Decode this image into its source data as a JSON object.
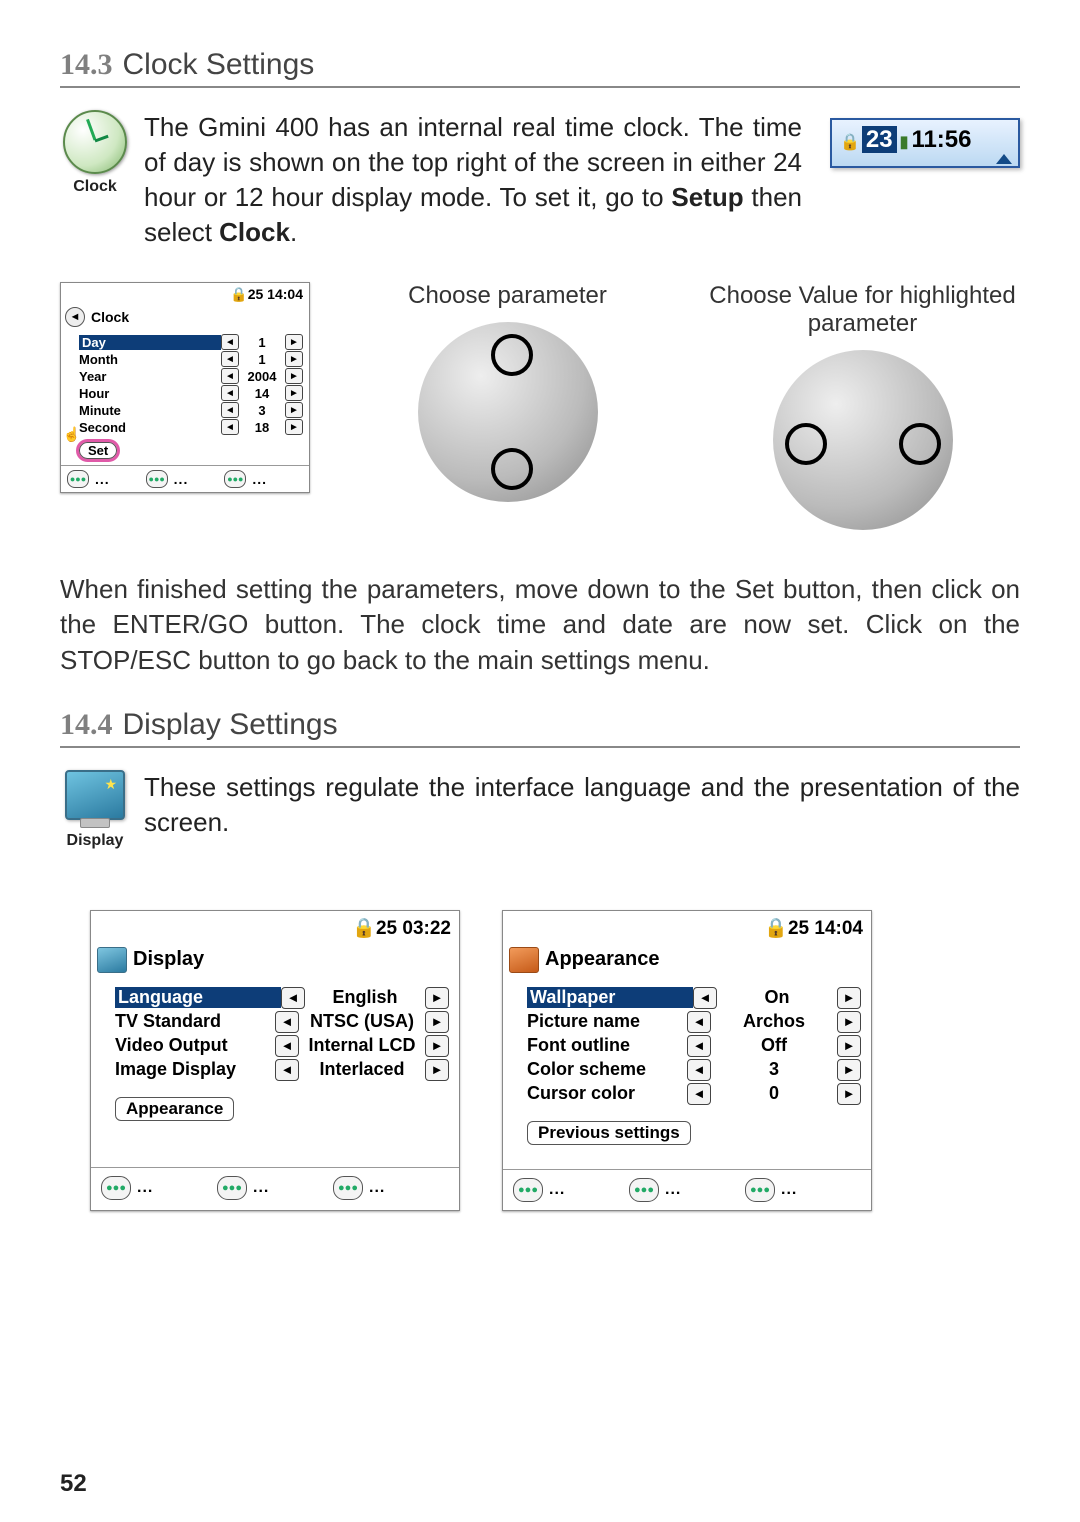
{
  "section_14_3": {
    "number": "14.3",
    "title": "Clock Settings",
    "icon_label": "Clock",
    "intro_fragments": {
      "p1": "The Gmini 400 has an internal real time clock. The time of day is shown on the top right of the screen in either 24 hour or 12 hour display mode. To set it, go to ",
      "b1": "Setup",
      "p2": " then select ",
      "b2": "Clock",
      "p3": "."
    },
    "time_example": {
      "hl": "23",
      "rest": "11:56"
    },
    "caption_param": "Choose parameter",
    "caption_value": "Choose Value for highlighted parameter",
    "clock_device": {
      "status": "25 14:04",
      "title": "Clock",
      "rows": [
        {
          "label": "Day",
          "value": "1",
          "selected": true
        },
        {
          "label": "Month",
          "value": "1",
          "selected": false
        },
        {
          "label": "Year",
          "value": "2004",
          "selected": false
        },
        {
          "label": "Hour",
          "value": "14",
          "selected": false
        },
        {
          "label": "Minute",
          "value": "3",
          "selected": false
        },
        {
          "label": "Second",
          "value": "18",
          "selected": false
        }
      ],
      "set_label": "Set"
    },
    "closing": "When finished setting the parameters, move down to the Set button, then click on the ENTER/GO button. The clock time and date are now set. Click on the STOP/ESC button to go back to the main settings menu."
  },
  "section_14_4": {
    "number": "14.4",
    "title": "Display Settings",
    "icon_label": "Display",
    "intro": "These settings regulate the interface language and the presentation of the screen.",
    "display_device": {
      "status": "25 03:22",
      "title": "Display",
      "rows": [
        {
          "label": "Language",
          "value": "English",
          "selected": true
        },
        {
          "label": "TV Standard",
          "value": "NTSC (USA)",
          "selected": false
        },
        {
          "label": "Video Output",
          "value": "Internal LCD",
          "selected": false
        },
        {
          "label": "Image Display",
          "value": "Interlaced",
          "selected": false
        }
      ],
      "link_label": "Appearance"
    },
    "appearance_device": {
      "status": "25 14:04",
      "title": "Appearance",
      "rows": [
        {
          "label": "Wallpaper",
          "value": "On",
          "selected": true
        },
        {
          "label": "Picture name",
          "value": "Archos",
          "selected": false
        },
        {
          "label": "Font outline",
          "value": "Off",
          "selected": false
        },
        {
          "label": "Color scheme",
          "value": "3",
          "selected": false
        },
        {
          "label": "Cursor color",
          "value": "0",
          "selected": false
        }
      ],
      "link_label": "Previous settings"
    }
  },
  "page_number": "52",
  "dots": "..."
}
